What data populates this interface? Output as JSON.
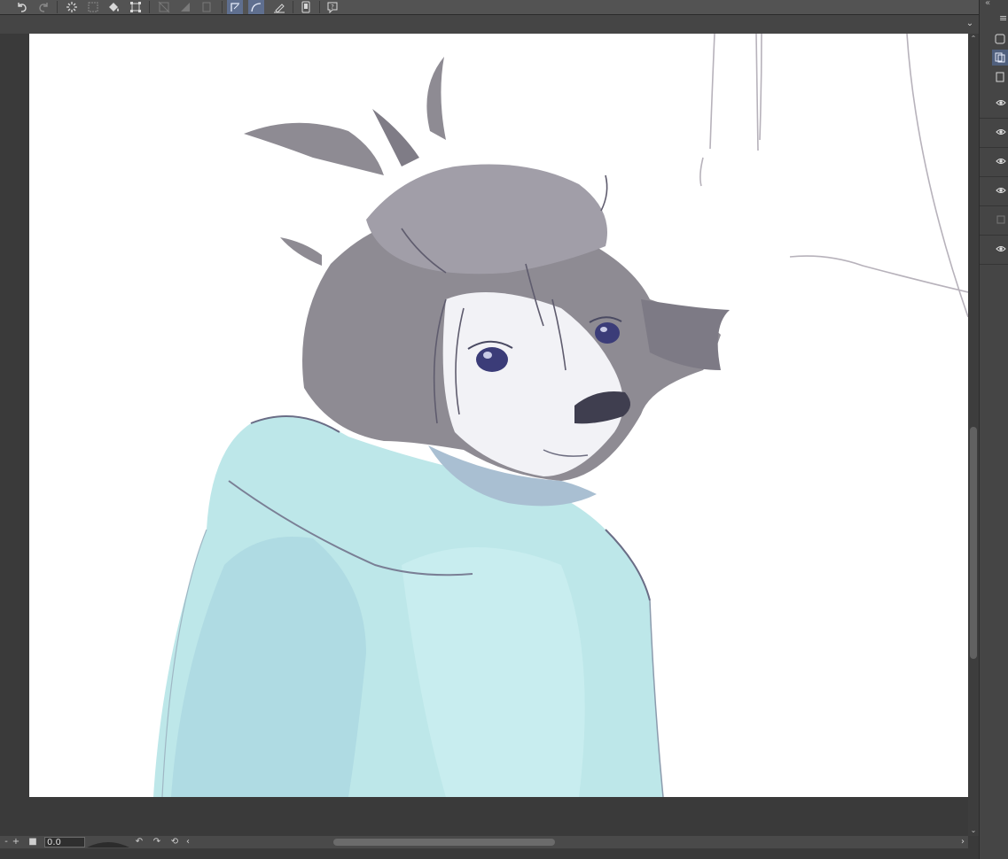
{
  "toolbar": {
    "icons": [
      "undo-icon",
      "redo-icon",
      "loading-icon",
      "selection-clear-icon",
      "fill-icon",
      "transform-icon",
      "crop-icon",
      "mask-icon",
      "layer-icon",
      "ruler-snap-icon",
      "curve-snap-icon",
      "pen-icon",
      "device-icon",
      "help-icon"
    ]
  },
  "tabbar": {
    "collapse_glyph": "⌄"
  },
  "status": {
    "minus_glyph": "-",
    "plus_glyph": "+",
    "stop_glyph": "■",
    "rotation_value": "0.0",
    "left_arrow": "‹",
    "right_arrow": "›",
    "rotate_ccw_glyph": "↶",
    "rotate_cw_glyph": "↷",
    "reset_glyph": "⟲"
  },
  "scroll": {
    "up_glyph": "⌃",
    "down_glyph": "⌄"
  },
  "right_panel": {
    "menu_glyph": "≡",
    "collapse_glyph": "«",
    "layers": [
      {
        "visible": true
      },
      {
        "visible": true
      },
      {
        "visible": true
      },
      {
        "visible": true
      },
      {
        "visible": false
      },
      {
        "visible": true
      }
    ]
  },
  "colors": {
    "app_bg": "#3a3a3a",
    "toolbar_bg": "#535353",
    "active_tool": "#5f6f8f",
    "hoodie": "#bfe8e8",
    "hair": "#8f8c94",
    "eye": "#3b3c78"
  }
}
